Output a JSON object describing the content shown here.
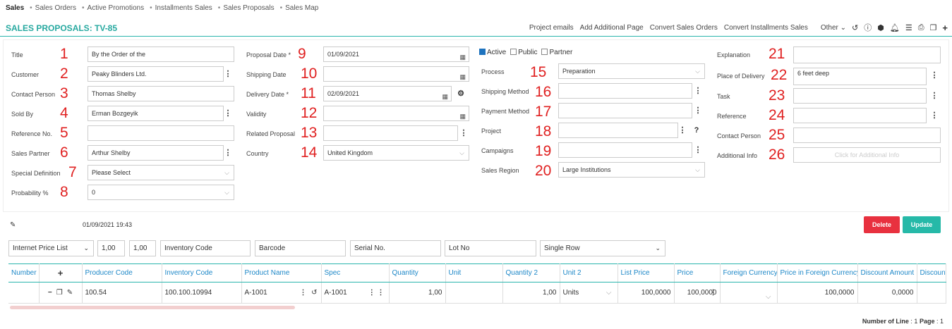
{
  "nav": {
    "items": [
      "Sales",
      "Sales Orders",
      "Active Promotions",
      "Installments Sales",
      "Sales Proposals",
      "Sales Map"
    ]
  },
  "header": {
    "title": "SALES PROPOSALS: TV-85",
    "actions": [
      "Project emails",
      "Add Additional Page",
      "Convert Sales Orders",
      "Convert Installments Sales",
      "Other"
    ]
  },
  "form": {
    "col1": [
      {
        "label": "Title",
        "num": "1",
        "value": "By the Order of the",
        "dots": false,
        "select": false
      },
      {
        "label": "Customer",
        "num": "2",
        "value": "Peaky Blinders Ltd.",
        "dots": true,
        "select": false
      },
      {
        "label": "Contact Person",
        "num": "3",
        "value": "Thomas Shelby",
        "dots": false,
        "select": false
      },
      {
        "label": "Sold By",
        "num": "4",
        "value": "Erman Bozgeyik",
        "dots": true,
        "select": false
      },
      {
        "label": "Reference No.",
        "num": "5",
        "value": "",
        "dots": false,
        "select": false
      },
      {
        "label": "Sales Partner",
        "num": "6",
        "value": "Arthur Shelby",
        "dots": true,
        "select": false
      },
      {
        "label": "Special Definition",
        "num": "7",
        "value": "Please Select",
        "dots": false,
        "select": true
      },
      {
        "label": "Probability %",
        "num": "8",
        "value": "0",
        "dots": false,
        "select": true
      }
    ],
    "col2": [
      {
        "label": "Proposal Date *",
        "num": "9",
        "value": "01/09/2021",
        "kind": "date"
      },
      {
        "label": "Shipping Date",
        "num": "10",
        "value": "",
        "kind": "date"
      },
      {
        "label": "Delivery Date *",
        "num": "11",
        "value": "02/09/2021",
        "kind": "date2"
      },
      {
        "label": "Validity",
        "num": "12",
        "value": "",
        "kind": "date"
      },
      {
        "label": "Related Proposal",
        "num": "13",
        "value": "",
        "kind": "dots"
      },
      {
        "label": "Country",
        "num": "14",
        "value": "United Kingdom",
        "kind": "select"
      }
    ],
    "checks": {
      "active": "Active",
      "public": "Public",
      "partner": "Partner"
    },
    "col3": [
      {
        "label": "Process",
        "num": "15",
        "value": "Preparation",
        "kind": "select"
      },
      {
        "label": "Shipping Method",
        "num": "16",
        "value": "",
        "kind": "dots"
      },
      {
        "label": "Payment Method",
        "num": "17",
        "value": "",
        "kind": "dots"
      },
      {
        "label": "Project",
        "num": "18",
        "value": "",
        "kind": "dotsq"
      },
      {
        "label": "Campaigns",
        "num": "19",
        "value": "",
        "kind": "dots"
      },
      {
        "label": "Sales Region",
        "num": "20",
        "value": "Large Institutions",
        "kind": "select"
      }
    ],
    "col4": [
      {
        "label": "Explanation",
        "num": "21",
        "value": "",
        "kind": "textarea"
      },
      {
        "label": "Place of Delivery",
        "num": "22",
        "value": "6 feet deep",
        "kind": "textarea-dots"
      },
      {
        "label": "Task",
        "num": "23",
        "value": "",
        "kind": "dots"
      },
      {
        "label": "Reference",
        "num": "24",
        "value": "",
        "kind": "dots"
      },
      {
        "label": "Contact Person",
        "num": "25",
        "value": "",
        "kind": "plain"
      },
      {
        "label": "Additional Info",
        "num": "26",
        "value": "Click for Additional Info",
        "kind": "button"
      }
    ]
  },
  "record": {
    "timestamp": "01/09/2021 19:43",
    "delete": "Delete",
    "update": "Update"
  },
  "filters": [
    "Internet Price List",
    "1,00",
    "1,00",
    "Inventory Code",
    "Barcode",
    "Serial No.",
    "Lot No",
    "Single Row"
  ],
  "grid": {
    "headers": [
      "Number",
      "+",
      "Producer Code",
      "Inventory Code",
      "Product Name",
      "Spec",
      "Quantity",
      "Unit",
      "Quantity 2",
      "Unit 2",
      "List Price",
      "Price",
      "Foreign Currency",
      "Price in Foreign Currency",
      "Discount Amount",
      "Discount"
    ],
    "row": [
      "",
      "",
      "100.54",
      "100.100.10994",
      "A-1001",
      "A-1001",
      "1,00",
      "",
      "1,00",
      "Units",
      "100,0000",
      "100,0000",
      "",
      "100,0000",
      "0,0000",
      ""
    ]
  },
  "footer": {
    "lines_label": "Number of Line",
    "lines": "1",
    "page_label": "Page",
    "page": "1"
  },
  "colors": {
    "accent": "#2ab6ad",
    "header_text": "#1e88c8",
    "delete": "#e8313f",
    "update": "#26b9a8",
    "marker": "#e02020"
  }
}
